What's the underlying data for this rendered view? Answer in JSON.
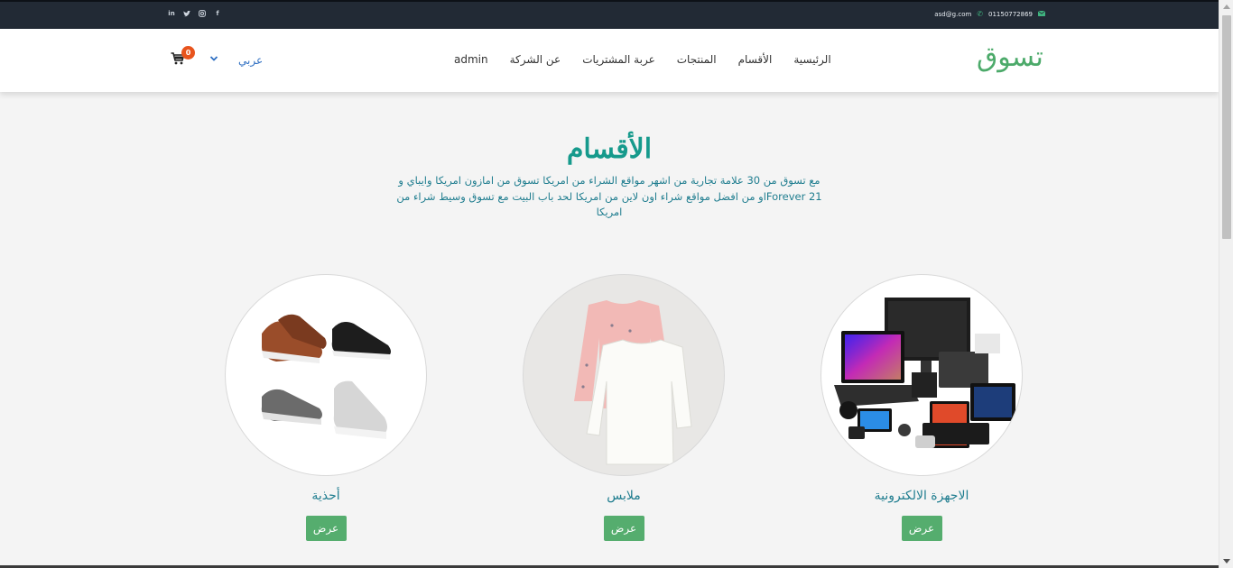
{
  "topbar": {
    "social_icons": [
      "linkedin-icon",
      "twitter-icon",
      "instagram-icon",
      "facebook-icon"
    ],
    "phone": "01150772869",
    "email": "asd@g.com"
  },
  "navbar": {
    "brand": "تسوق",
    "menu": [
      {
        "label": "الرئيسية"
      },
      {
        "label": "الأقسام"
      },
      {
        "label": "المنتجات"
      },
      {
        "label": "عربة المشتريات"
      },
      {
        "label": "عن الشركة"
      },
      {
        "label": "admin"
      }
    ],
    "language": "عربي",
    "cart_count": "0"
  },
  "section": {
    "title": "الأقسام",
    "description": "مع تسوق من 30 علامة تجارية من اشهر مواقع الشراء من امريكا تسوق من امازون امريكا وايباي و Forever 21او من افضل مواقع شراء اون لاين من امريكا لحد باب البيت مع تسوق وسيط شراء من امريكا"
  },
  "categories": [
    {
      "name": "الاجهزة الالكترونية",
      "button": "عرض"
    },
    {
      "name": "ملابس",
      "button": "عرض"
    },
    {
      "name": "أحذية",
      "button": "عرض"
    }
  ],
  "colors": {
    "accent": "#169a8c",
    "brand": "#4caa6a",
    "button": "#55ad6e",
    "badge": "#e8541d",
    "topbar": "#222a35"
  }
}
